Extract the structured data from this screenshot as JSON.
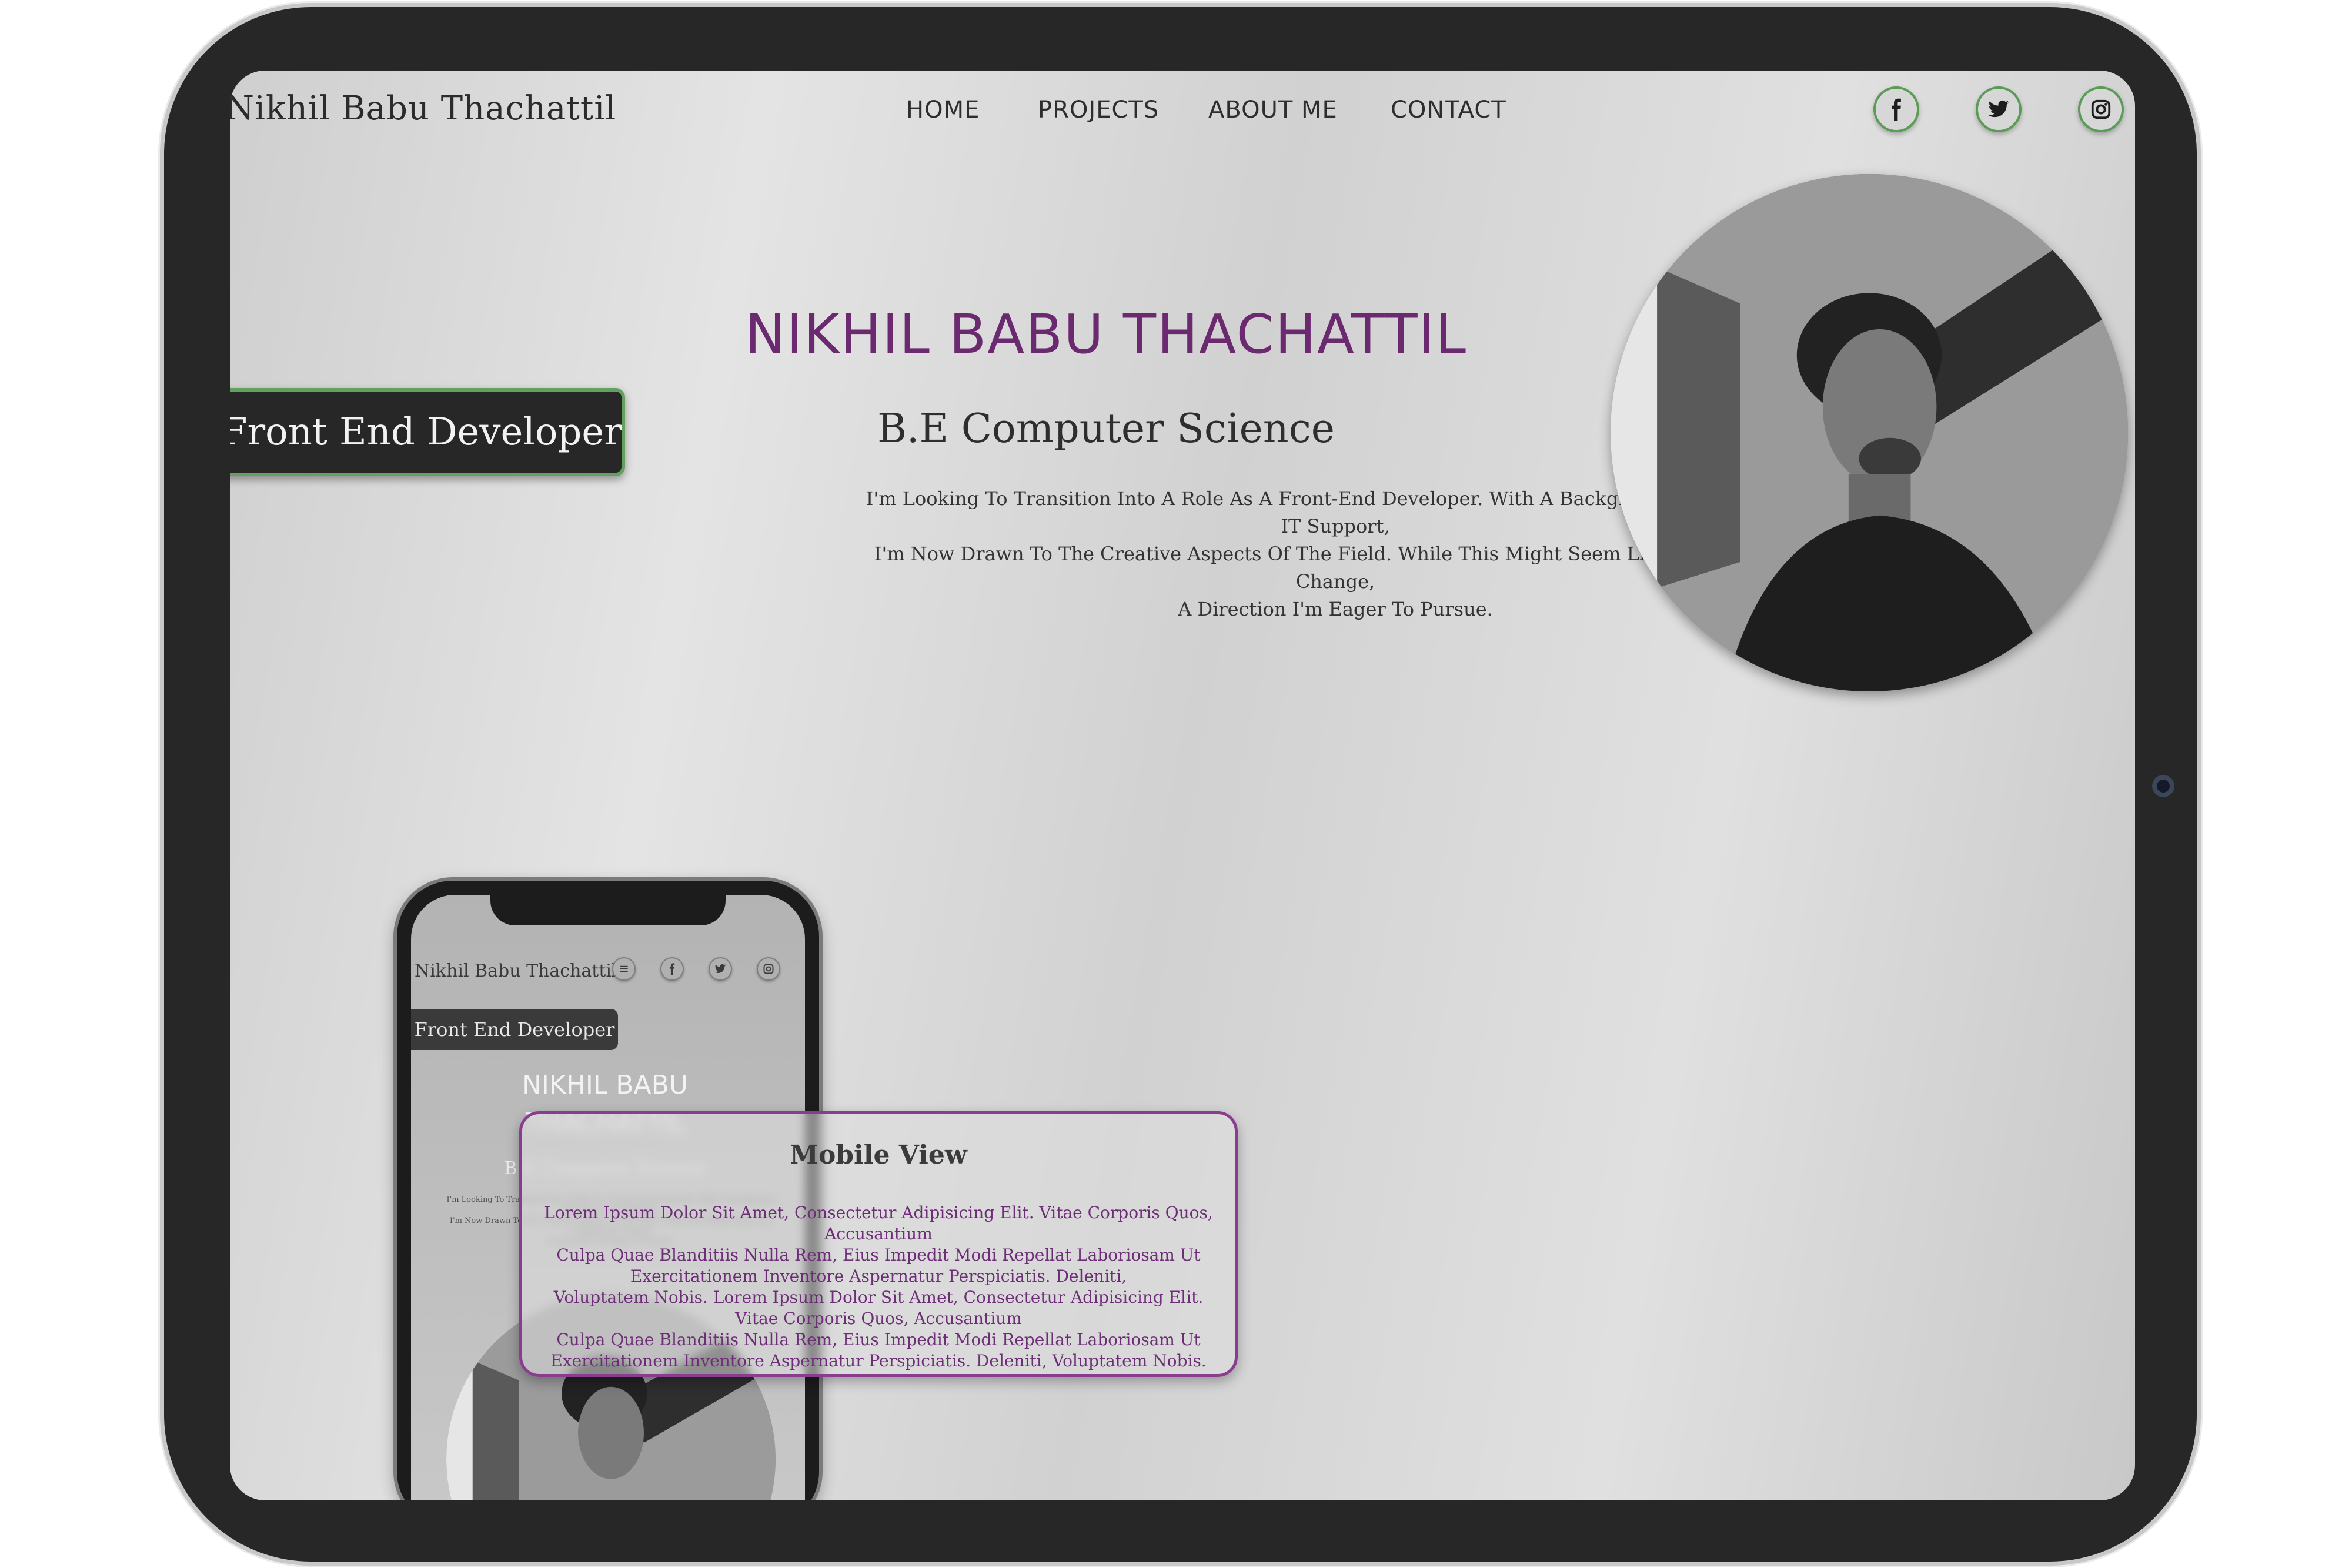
{
  "header": {
    "brand": "Nikhil Babu Thachattil",
    "nav": [
      "HOME",
      "PROJECTS",
      "ABOUT ME",
      "CONTACT"
    ],
    "social_icons": [
      "facebook-icon",
      "twitter-icon",
      "instagram-icon"
    ]
  },
  "hero": {
    "role_badge": "Front End Developer",
    "title": "NIKHIL BABU THACHATTIL",
    "subtitle": "B.E Computer Science",
    "description": [
      "I'm Looking To Transition Into A Role As A Front-End Developer. With A Background Of 6 Years In IT Support,",
      "I'm Now Drawn To The Creative Aspects Of The Field. While This Might Seem Like A Significant Change,",
      "A Direction I'm Eager To Pursue."
    ]
  },
  "mobile_preview": {
    "brand": "Nikhil Babu Thachattil",
    "icons": [
      "menu-icon",
      "facebook-icon",
      "twitter-icon",
      "instagram-icon"
    ],
    "badge": "Front End Developer",
    "title_lines": [
      "NIKHIL BABU",
      "THACHATTIL"
    ],
    "subtitle": "B.E Computer Science",
    "description": [
      "I'm Looking To Transition Into A Role As A Front-End Developer. With A Background",
      "Of 6 Years In IT Support,",
      "I'm Now Drawn To The Creative Aspects Of The Field. While This Might Seem Like",
      "A Significant Change,",
      "A Direction I'm Eager To Pursue."
    ]
  },
  "mobile_card": {
    "title": "Mobile View",
    "lines": [
      "Lorem Ipsum Dolor Sit Amet, Consectetur Adipisicing Elit. Vitae Corporis Quos, Accusantium",
      "Culpa Quae Blanditiis Nulla Rem, Eius Impedit Modi Repellat Laboriosam Ut",
      "Exercitationem Inventore Aspernatur Perspiciatis. Deleniti,",
      "Voluptatem Nobis. Lorem Ipsum Dolor Sit Amet, Consectetur Adipisicing Elit.",
      "Vitae Corporis Quos, Accusantium",
      "Culpa Quae Blanditiis Nulla Rem, Eius Impedit Modi Repellat Laboriosam Ut",
      "Exercitationem Inventore Aspernatur Perspiciatis. Deleniti, Voluptatem Nobis."
    ]
  },
  "colors": {
    "accent_purple": "#6b2a70",
    "accent_green": "#5a9b55",
    "dark": "#272727"
  }
}
